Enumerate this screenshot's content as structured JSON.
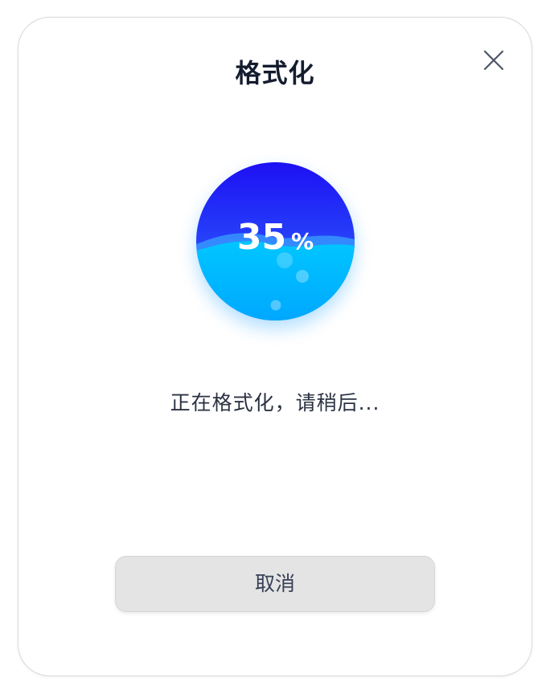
{
  "dialog": {
    "title": "格式化",
    "close_icon": "close-icon",
    "progress": {
      "value": 35,
      "value_text": "35",
      "unit": "%",
      "colors": {
        "top": "#1d10f4",
        "mid": "#2f72ff",
        "water": "#00b9ff",
        "water_deep": "#00a8ff"
      }
    },
    "status_text": "正在格式化，请稍后...",
    "cancel_label": "取消"
  }
}
